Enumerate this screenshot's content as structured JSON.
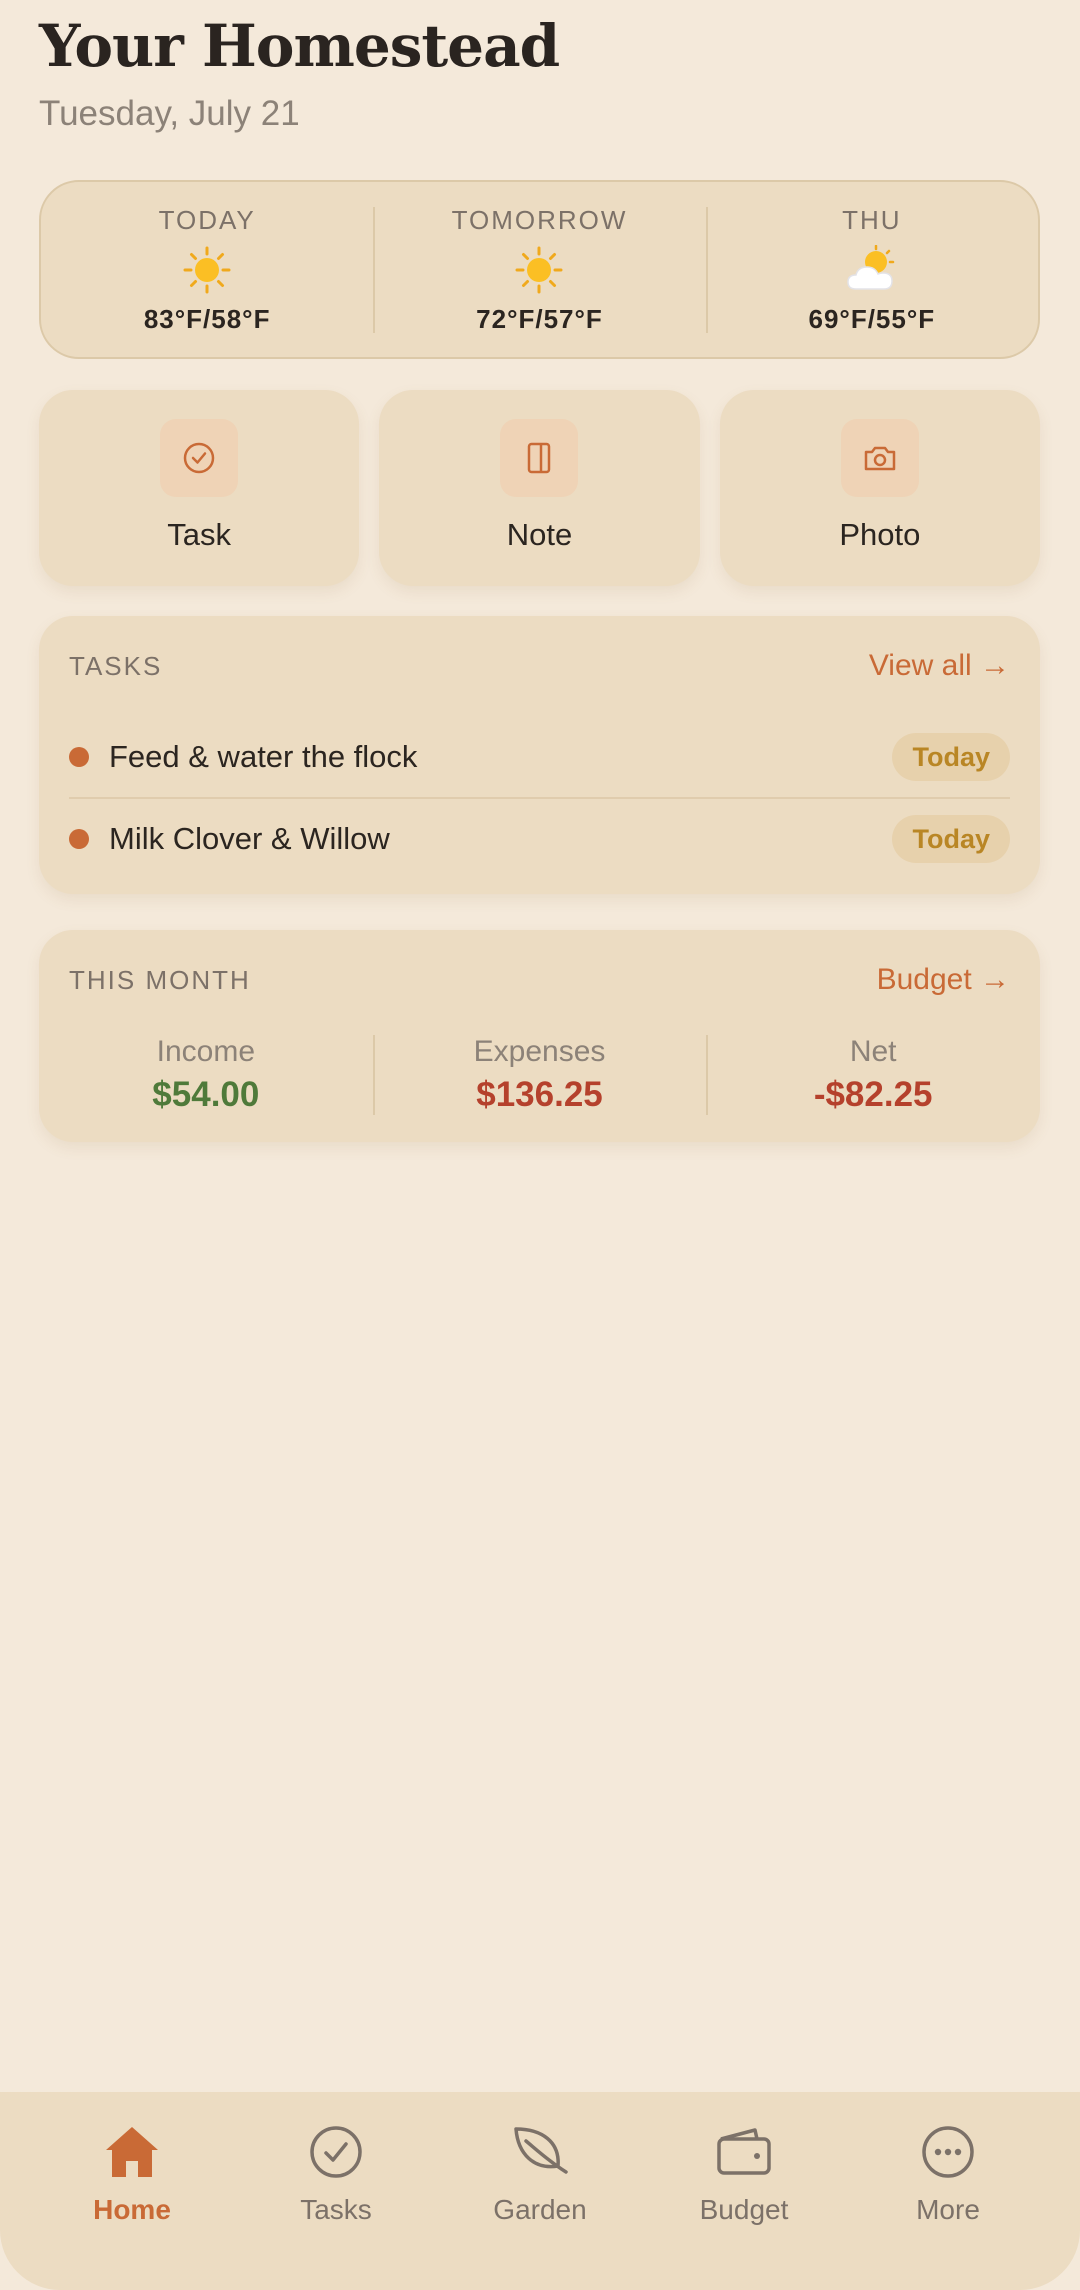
{
  "header": {
    "title": "Your Homestead",
    "date": "Tuesday, July 21"
  },
  "weather": [
    {
      "label": "TODAY",
      "icon": "sun-icon",
      "temp": "83°F/58°F"
    },
    {
      "label": "TOMORROW",
      "icon": "sun-icon",
      "temp": "72°F/57°F"
    },
    {
      "label": "THU",
      "icon": "sun-behind-cloud-icon",
      "temp": "69°F/55°F"
    }
  ],
  "quick_actions": [
    {
      "label": "Task",
      "icon": "check-circle-icon"
    },
    {
      "label": "Note",
      "icon": "notebook-icon"
    },
    {
      "label": "Photo",
      "icon": "camera-icon"
    }
  ],
  "tasks": {
    "heading": "TASKS",
    "link": "View all →",
    "items": [
      {
        "text": "Feed & water the flock",
        "due": "Today"
      },
      {
        "text": "Milk Clover & Willow",
        "due": "Today"
      }
    ]
  },
  "month": {
    "heading": "THIS MONTH",
    "link": "Budget →",
    "stats": [
      {
        "label": "Income",
        "value": "$54.00",
        "color": "#4f7a3a"
      },
      {
        "label": "Expenses",
        "value": "$136.25",
        "color": "#b5412c"
      },
      {
        "label": "Net",
        "value": "-$82.25",
        "color": "#b5412c"
      }
    ]
  },
  "nav": {
    "active": "Home",
    "items": [
      {
        "label": "Home",
        "icon": "home-icon"
      },
      {
        "label": "Tasks",
        "icon": "check-circle-icon"
      },
      {
        "label": "Garden",
        "icon": "leaf-icon"
      },
      {
        "label": "Budget",
        "icon": "wallet-icon"
      },
      {
        "label": "More",
        "icon": "more-icon"
      }
    ]
  },
  "colors": {
    "background": "#f4e9da",
    "card": "#ecdcc2",
    "accent": "#c96a36",
    "badge_text": "#b98625"
  }
}
